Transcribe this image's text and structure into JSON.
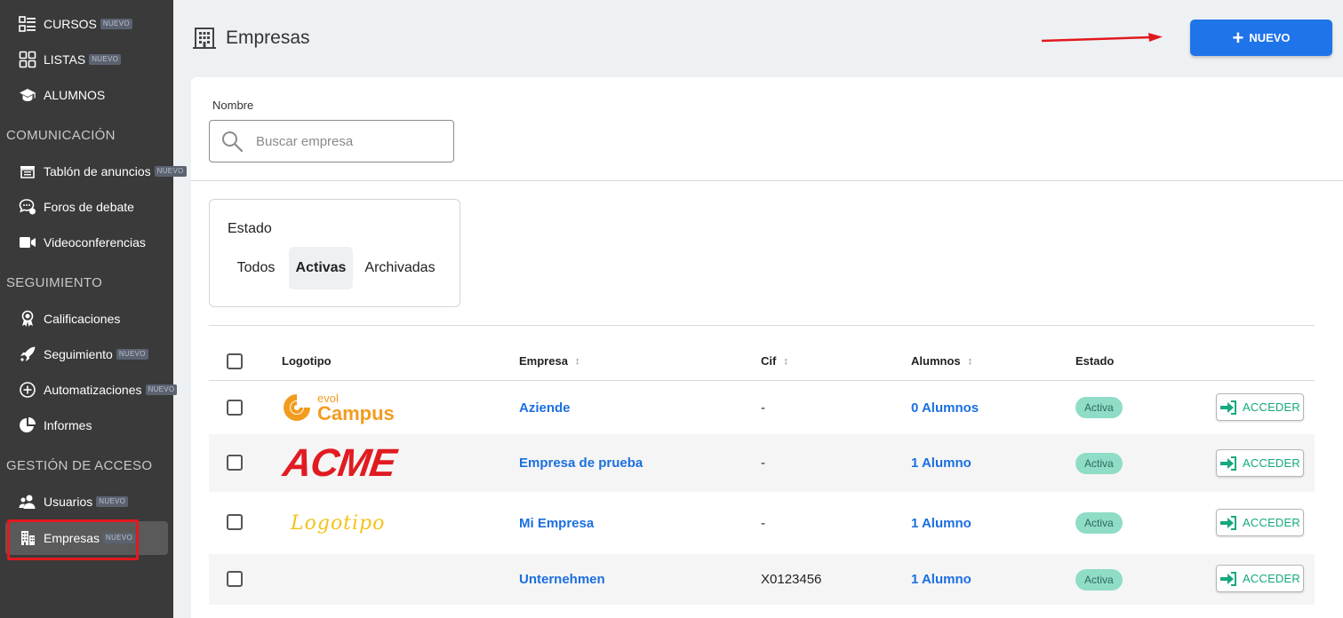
{
  "sidebar": {
    "new_badge": "NUEVO",
    "items_top": [
      {
        "label": "CURSOS",
        "icon": "list-icon",
        "new": true
      },
      {
        "label": "LISTAS",
        "icon": "grid-icon",
        "new": true
      },
      {
        "label": "ALUMNOS",
        "icon": "graduation-cap-icon",
        "new": false
      }
    ],
    "sections": {
      "comunicacion": "COMUNICACIÓN",
      "seguimiento": "SEGUIMIENTO",
      "gestion": "GESTIÓN DE ACCESO"
    },
    "comunicacion_items": [
      {
        "label": "Tablón de anuncios",
        "icon": "board-icon",
        "new": true
      },
      {
        "label": "Foros de debate",
        "icon": "forum-icon",
        "new": false
      },
      {
        "label": "Videoconferencias",
        "icon": "video-icon",
        "new": false
      }
    ],
    "seguimiento_items": [
      {
        "label": "Calificaciones",
        "icon": "medal-icon",
        "new": false
      },
      {
        "label": "Seguimiento",
        "icon": "rocket-icon",
        "new": true
      },
      {
        "label": "Automatizaciones",
        "icon": "automation-icon",
        "new": true
      },
      {
        "label": "Informes",
        "icon": "pie-chart-icon",
        "new": false
      }
    ],
    "gestion_items": [
      {
        "label": "Usuarios",
        "icon": "users-icon",
        "new": true
      },
      {
        "label": "Empresas",
        "icon": "buildings-icon",
        "new": true,
        "active": true
      }
    ]
  },
  "header": {
    "title": "Empresas",
    "new_button": "NUEVO"
  },
  "filters": {
    "nombre_label": "Nombre",
    "search_placeholder": "Buscar empresa",
    "estado_label": "Estado",
    "estado_options": [
      "Todos",
      "Activas",
      "Archivadas"
    ],
    "estado_selected": "Activas"
  },
  "table": {
    "headers": {
      "logotipo": "Logotipo",
      "empresa": "Empresa",
      "cif": "Cif",
      "alumnos": "Alumnos",
      "estado": "Estado"
    },
    "action_label": "ACCEDER",
    "rows": [
      {
        "logo_type": "evol",
        "logo_small": "evol",
        "logo_big": "Campus",
        "empresa": "Aziende",
        "cif": "-",
        "alumnos": "0 Alumnos",
        "estado": "Activa"
      },
      {
        "logo_type": "acme",
        "logo_text": "ACME",
        "empresa": "Empresa de prueba",
        "cif": "-",
        "alumnos": "1 Alumno",
        "estado": "Activa"
      },
      {
        "logo_type": "text",
        "logo_text": "Logotipo",
        "empresa": "Mi Empresa",
        "cif": "-",
        "alumnos": "1 Alumno",
        "estado": "Activa"
      },
      {
        "logo_type": "none",
        "empresa": "Unternehmen",
        "cif": "X0123456",
        "alumnos": "1 Alumno",
        "estado": "Activa"
      }
    ]
  },
  "colors": {
    "sidebar_bg": "#3a3a3a",
    "accent": "#1f74ea",
    "link": "#1b6fe0",
    "status_bg": "#8fdcc7",
    "acceder": "#16a87f",
    "highlight": "#e1191f"
  }
}
